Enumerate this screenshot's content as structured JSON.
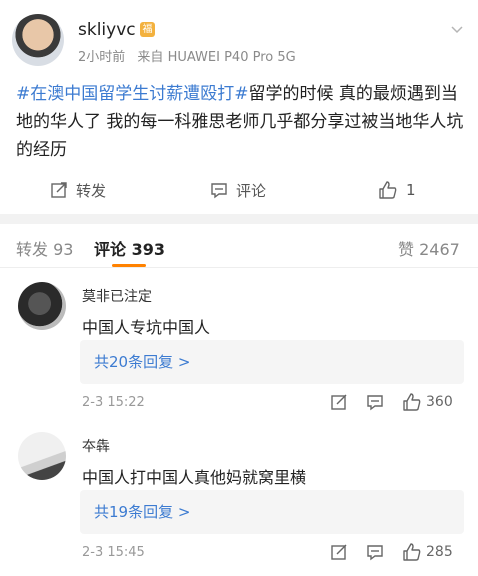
{
  "post": {
    "author": "skliyvc",
    "badge": "福",
    "time": "2小时前",
    "source_prefix": "来自",
    "source": "HUAWEI P40 Pro 5G",
    "hashtag": "#在澳中国留学生讨薪遭殴打#",
    "text": "留学的时候 真的最烦遇到当地的华人了 我的每一科雅思老师几乎都分享过被当地华人坑的经历",
    "actions": {
      "repost_label": "转发",
      "comment_label": "评论",
      "like_count": "1"
    }
  },
  "tabs": {
    "repost": "转发 93",
    "comment": "评论 393",
    "like": "赞 2467"
  },
  "comments": [
    {
      "name": "莫非已注定",
      "text": "中国人专坑中国人",
      "replies": "共20条回复 >",
      "time": "2-3 15:22",
      "likes": "360"
    },
    {
      "name": "夲犇",
      "text": "中国人打中国人真他妈就窝里横",
      "replies": "共19条回复 >",
      "time": "2-3 15:45",
      "likes": "285"
    }
  ],
  "colors": {
    "hashtag": "#3c7bd1",
    "tab_accent": "#ff8200",
    "badge": "#f3b13e"
  }
}
